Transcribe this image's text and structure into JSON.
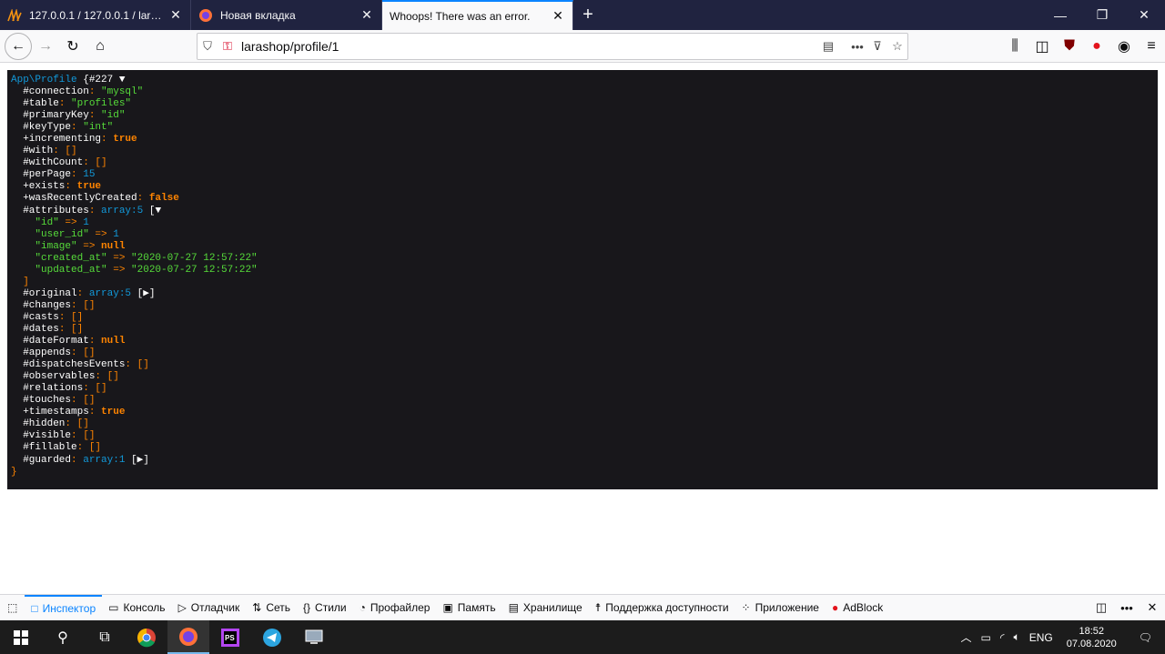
{
  "tabs": [
    {
      "title": "127.0.0.1 / 127.0.0.1 / larashop / ...",
      "icon": "phpmyadmin-icon"
    },
    {
      "title": "Новая вкладка",
      "icon": "firefox-icon"
    },
    {
      "title": "Whoops! There was an error.",
      "icon": "none",
      "active": true
    }
  ],
  "url": "larashop/profile/1",
  "dump": {
    "class_name": "App\\Profile",
    "object_id": "{#227 ▼",
    "rows": [
      {
        "k": "  #connection",
        "v": "\"mysql\"",
        "t": "str"
      },
      {
        "k": "  #table",
        "v": "\"profiles\"",
        "t": "str"
      },
      {
        "k": "  #primaryKey",
        "v": "\"id\"",
        "t": "str"
      },
      {
        "k": "  #keyType",
        "v": "\"int\"",
        "t": "str"
      },
      {
        "k": "  +incrementing",
        "v": "true",
        "t": "kw"
      },
      {
        "k": "  #with",
        "v": "[]",
        "t": "bra"
      },
      {
        "k": "  #withCount",
        "v": "[]",
        "t": "bra"
      },
      {
        "k": "  #perPage",
        "v": "15",
        "t": "num"
      },
      {
        "k": "  +exists",
        "v": "true",
        "t": "kw"
      },
      {
        "k": "  +wasRecentlyCreated",
        "v": "false",
        "t": "kw"
      },
      {
        "k": "  #attributes",
        "v": "array:5",
        "t": "num",
        "suffix": " [▼"
      },
      {
        "k": "    \"id\"",
        "arrow": " => ",
        "v": "1",
        "t": "num",
        "akey": true
      },
      {
        "k": "    \"user_id\"",
        "arrow": " => ",
        "v": "1",
        "t": "num",
        "akey": true
      },
      {
        "k": "    \"image\"",
        "arrow": " => ",
        "v": "null",
        "t": "kw",
        "akey": true
      },
      {
        "k": "    \"created_at\"",
        "arrow": " => ",
        "v": "\"2020-07-27 12:57:22\"",
        "t": "str",
        "akey": true
      },
      {
        "k": "    \"updated_at\"",
        "arrow": " => ",
        "v": "\"2020-07-27 12:57:22\"",
        "t": "str",
        "akey": true
      },
      {
        "raw": "  ]"
      },
      {
        "k": "  #original",
        "v": "array:5",
        "t": "num",
        "suffix": " [▶]"
      },
      {
        "k": "  #changes",
        "v": "[]",
        "t": "bra"
      },
      {
        "k": "  #casts",
        "v": "[]",
        "t": "bra"
      },
      {
        "k": "  #dates",
        "v": "[]",
        "t": "bra"
      },
      {
        "k": "  #dateFormat",
        "v": "null",
        "t": "kw"
      },
      {
        "k": "  #appends",
        "v": "[]",
        "t": "bra"
      },
      {
        "k": "  #dispatchesEvents",
        "v": "[]",
        "t": "bra"
      },
      {
        "k": "  #observables",
        "v": "[]",
        "t": "bra"
      },
      {
        "k": "  #relations",
        "v": "[]",
        "t": "bra"
      },
      {
        "k": "  #touches",
        "v": "[]",
        "t": "bra"
      },
      {
        "k": "  +timestamps",
        "v": "true",
        "t": "kw"
      },
      {
        "k": "  #hidden",
        "v": "[]",
        "t": "bra"
      },
      {
        "k": "  #visible",
        "v": "[]",
        "t": "bra"
      },
      {
        "k": "  #fillable",
        "v": "[]",
        "t": "bra"
      },
      {
        "k": "  #guarded",
        "v": "array:1",
        "t": "num",
        "suffix": " [▶]"
      },
      {
        "raw": "}"
      }
    ]
  },
  "devtools": [
    {
      "label": "Инспектор",
      "icon": "□",
      "active": true
    },
    {
      "label": "Консоль",
      "icon": "▭"
    },
    {
      "label": "Отладчик",
      "icon": "▷"
    },
    {
      "label": "Сеть",
      "icon": "⇅"
    },
    {
      "label": "Стили",
      "icon": "{}"
    },
    {
      "label": "Профайлер",
      "icon": "◔"
    },
    {
      "label": "Память",
      "icon": "▣"
    },
    {
      "label": "Хранилище",
      "icon": "▤"
    },
    {
      "label": "Поддержка доступности",
      "icon": "☨"
    },
    {
      "label": "Приложение",
      "icon": "⁘"
    },
    {
      "label": "AdBlock",
      "icon": "●"
    }
  ],
  "tray": {
    "lang": "ENG",
    "time": "18:52",
    "date": "07.08.2020"
  },
  "colors": {
    "dump_bg": "#18171b",
    "tabbar_bg": "#202340",
    "accent": "#0a84ff"
  }
}
